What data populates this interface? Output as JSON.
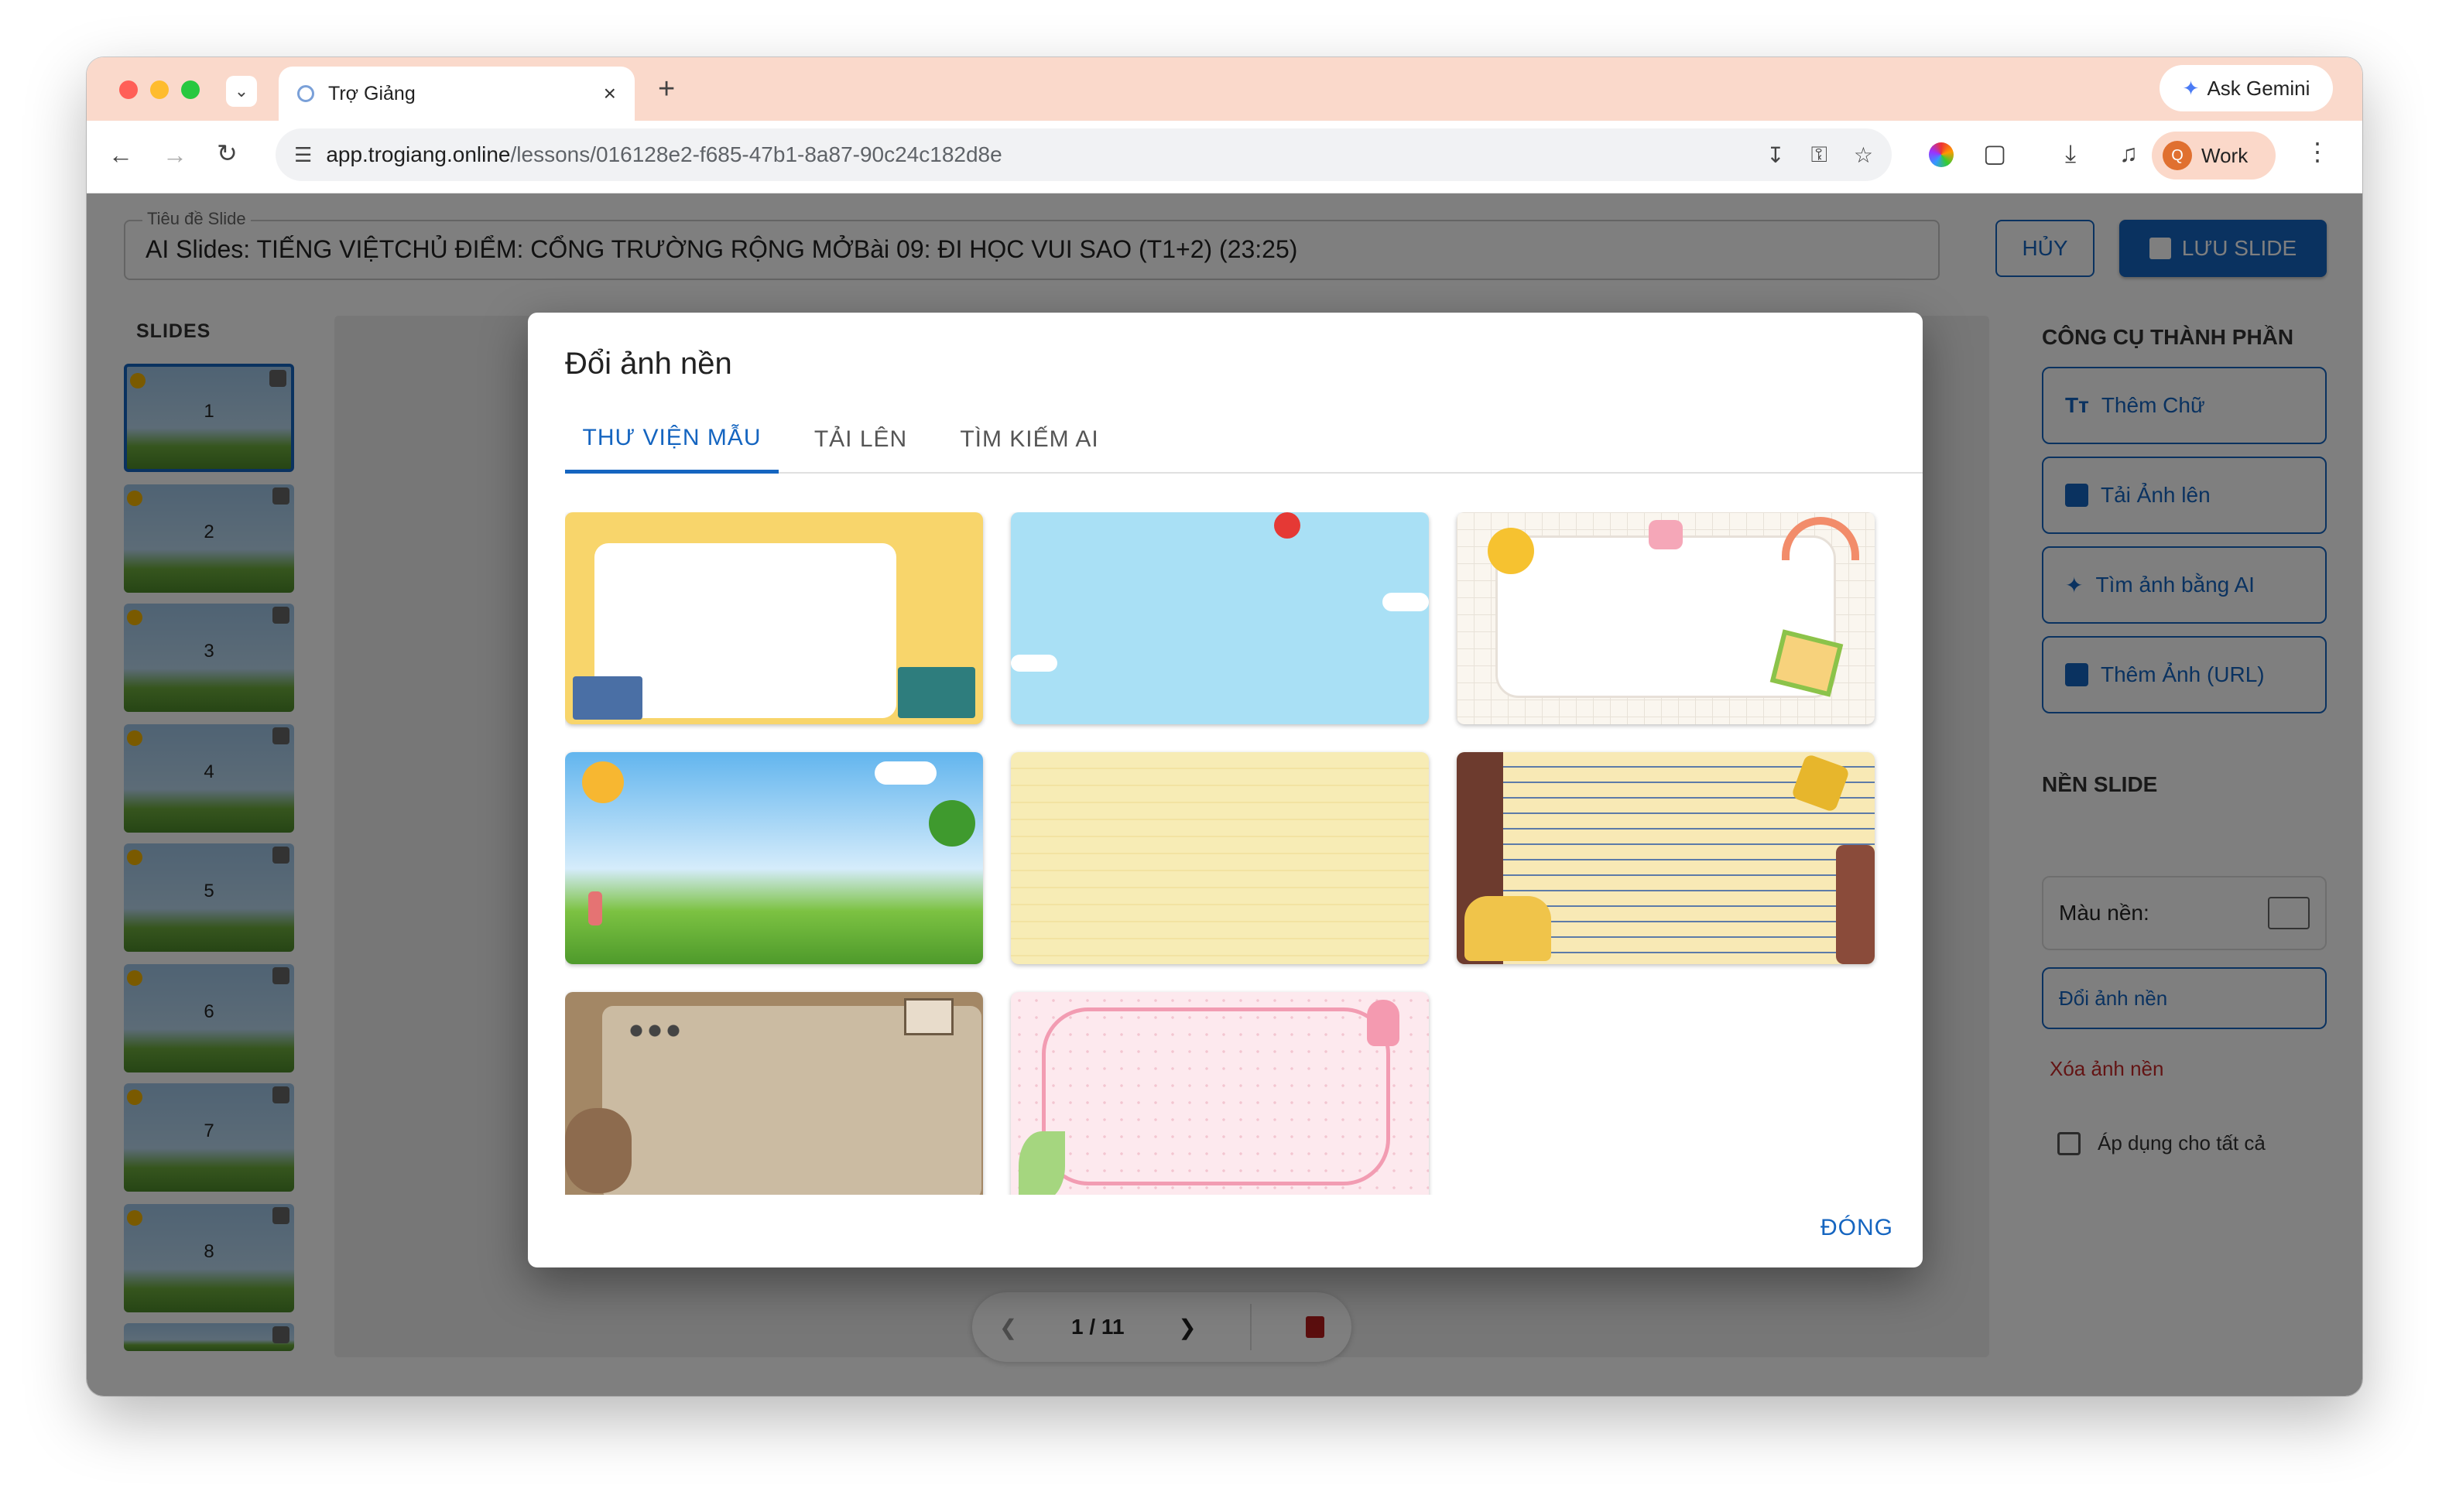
{
  "browser": {
    "tab_title": "Trợ Giảng",
    "url_domain": "app.trogiang.online",
    "url_path": "/lessons/016128e2-f685-47b1-8a87-90c24c182d8e",
    "ask_gemini": "Ask Gemini",
    "profile_initial": "Q",
    "profile_label": "Work"
  },
  "editor": {
    "title_label": "Tiêu đề Slide",
    "title_value": "AI Slides: TIẾNG VIỆTCHỦ ĐIỂM: CỔNG TRƯỜNG RỘNG MỞBài 09: ĐI HỌC VUI SAO (T1+2) (23:25)",
    "cancel": "HỦY",
    "save": "LƯU SLIDE",
    "slides_header": "SLIDES",
    "slides": [
      "1",
      "2",
      "3",
      "4",
      "5",
      "6",
      "7",
      "8"
    ],
    "pager": "1 / 11"
  },
  "right_panel": {
    "tools_header": "CÔNG CỤ THÀNH PHẦN",
    "add_text": "Thêm Chữ",
    "upload_image": "Tải Ảnh lên",
    "ai_image": "Tìm ảnh bằng AI",
    "add_image_url": "Thêm Ảnh (URL)",
    "bg_header": "NỀN SLIDE",
    "bg_color_label": "Màu nền:",
    "change_bg": "Đổi ảnh nền",
    "remove_bg": "Xóa ảnh nền",
    "apply_all": "Áp dụng cho tất cả"
  },
  "dialog": {
    "title": "Đổi ảnh nền",
    "tabs": [
      "THƯ VIỆN MẪU",
      "TẢI LÊN",
      "TÌM KIẾM AI"
    ],
    "active_tab": 0,
    "close": "ĐÓNG"
  },
  "colors": {
    "accent": "#1565c0",
    "chrome": "#fad9cb",
    "danger": "#c62828"
  }
}
